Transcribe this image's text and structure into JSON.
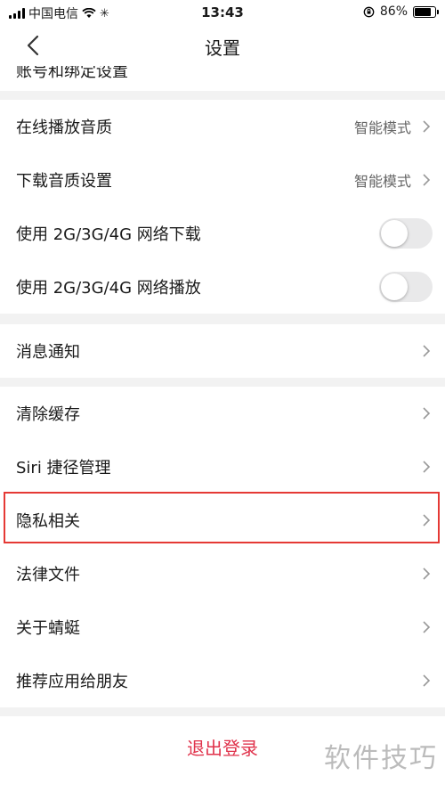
{
  "status_bar": {
    "carrier": "中国电信",
    "time": "13:43",
    "battery": "86%",
    "battery_level": 0.86
  },
  "nav": {
    "title": "设置",
    "back_icon": "chevron-left-icon"
  },
  "clipped_row": {
    "label": "账号和绑定设置"
  },
  "group_audio": [
    {
      "label": "在线播放音质",
      "value": "智能模式"
    },
    {
      "label": "下载音质设置",
      "value": "智能模式"
    },
    {
      "label": "使用 2G/3G/4G 网络下载",
      "toggle": false
    },
    {
      "label": "使用 2G/3G/4G 网络播放",
      "toggle": false
    }
  ],
  "group_notify": [
    {
      "label": "消息通知"
    }
  ],
  "group_misc": [
    {
      "label": "清除缓存"
    },
    {
      "label": "Siri 捷径管理"
    },
    {
      "label": "隐私相关"
    },
    {
      "label": "法律文件"
    },
    {
      "label": "关于蜻蜓"
    },
    {
      "label": "推荐应用给朋友"
    }
  ],
  "logout": {
    "label": "退出登录",
    "color": "#e0324b"
  },
  "watermark": "软件技巧",
  "colors": {
    "highlight": "#e53935"
  }
}
